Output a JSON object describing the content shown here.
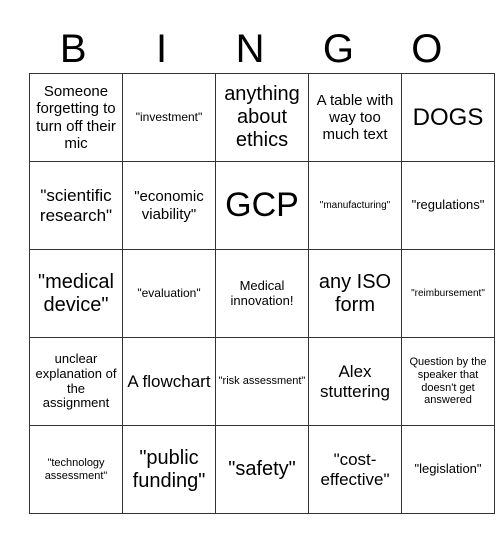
{
  "header": {
    "letters": [
      "B",
      "I",
      "N",
      "G",
      "O"
    ]
  },
  "rows": [
    [
      "Someone forgetting to turn off their mic",
      "\"investment\"",
      "anything about ethics",
      "A table with way too much text",
      "DOGS"
    ],
    [
      "\"scientific research\"",
      "\"economic viability\"",
      "GCP",
      "\"manufacturing\"",
      "\"regulations\""
    ],
    [
      "\"medical device\"",
      "\"evaluation\"",
      "Medical innovation!",
      "any ISO form",
      "\"reimbursement\""
    ],
    [
      "unclear explanation of the assignment",
      "A flowchart",
      "\"risk assessment\"",
      "Alex stuttering",
      "Question by the speaker that doesn't get answered"
    ],
    [
      "\"technology assessment\"",
      "\"public funding\"",
      "\"safety\"",
      "\"cost-effective\"",
      "\"legislation\""
    ]
  ]
}
